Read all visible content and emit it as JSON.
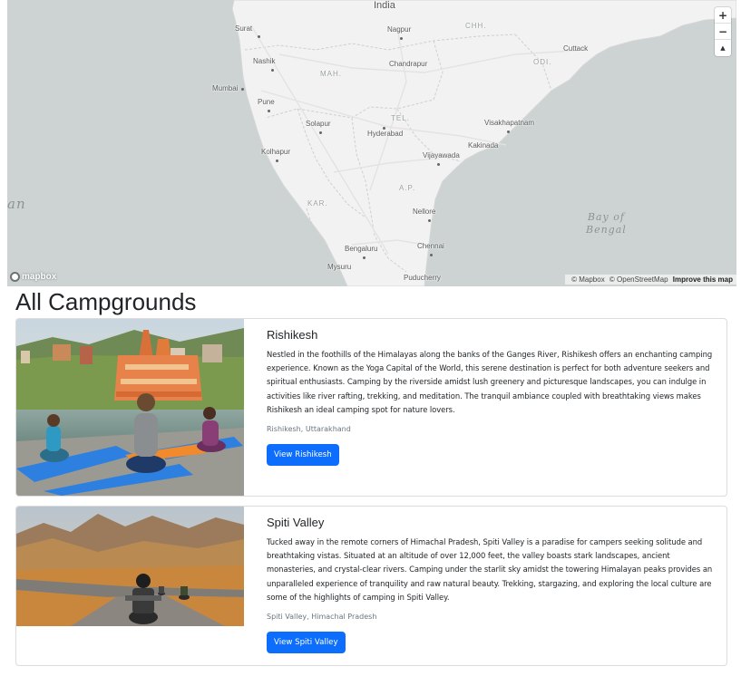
{
  "map": {
    "cities": [
      {
        "name": "Surat"
      },
      {
        "name": "Nagpur"
      },
      {
        "name": "Nashik"
      },
      {
        "name": "Chandrapur"
      },
      {
        "name": "Mumbai"
      },
      {
        "name": "Cuttack"
      },
      {
        "name": "Pune"
      },
      {
        "name": "Visakhapatnam"
      },
      {
        "name": "Solapur"
      },
      {
        "name": "Hyderabad"
      },
      {
        "name": "Kolhapur"
      },
      {
        "name": "Kakinada"
      },
      {
        "name": "Vijayawada"
      },
      {
        "name": "Nellore"
      },
      {
        "name": "Bengaluru"
      },
      {
        "name": "Chennai"
      },
      {
        "name": "Mysuru"
      },
      {
        "name": "Puducherry"
      }
    ],
    "regions": {
      "country": "India",
      "mah": "MAH.",
      "chh": "CHH.",
      "odi": "ODI.",
      "tel": "TEL.",
      "ap": "A.P.",
      "kar": "KAR."
    },
    "seas": {
      "arabian_partial": "an",
      "bay_line1": "Bay of",
      "bay_line2": "Bengal"
    },
    "controls": {
      "zoom_in": "+",
      "zoom_out": "−",
      "compass": "▲"
    },
    "logo_text": "mapbox",
    "attribution": {
      "mapbox": "© Mapbox",
      "osm": "© OpenStreetMap",
      "improve": "Improve this map"
    },
    "colors": {
      "water": "#cdd3d3",
      "land": "#f2f2f2",
      "border": "#c8c8c8"
    }
  },
  "page_title": "All Campgrounds",
  "campgrounds": [
    {
      "title": "Rishikesh",
      "description": "Nestled in the foothills of the Himalayas along the banks of the Ganges River, Rishikesh offers an enchanting camping experience. Known as the Yoga Capital of the World, this serene destination is perfect for both adventure seekers and spiritual enthusiasts. Camping by the riverside amidst lush greenery and picturesque landscapes, you can indulge in activities like river rafting, trekking, and meditation. The tranquil ambiance coupled with breathtaking views makes Rishikesh an ideal camping spot for nature lovers.",
      "location": "Rishikesh, Uttarakhand",
      "button_label": "View Rishikesh"
    },
    {
      "title": "Spiti Valley",
      "description": "Tucked away in the remote corners of Himachal Pradesh, Spiti Valley is a paradise for campers seeking solitude and breathtaking vistas. Situated at an altitude of over 12,000 feet, the valley boasts stark landscapes, ancient monasteries, and crystal-clear rivers. Camping under the starlit sky amidst the towering Himalayan peaks provides an unparalleled experience of tranquility and raw natural beauty. Trekking, stargazing, and exploring the local culture are some of the highlights of camping in Spiti Valley.",
      "location": "Spiti Valley, Himachal Pradesh",
      "button_label": "View Spiti Valley"
    }
  ],
  "colors": {
    "primary_button": "#0d6efd",
    "muted_text": "#6c757d"
  }
}
